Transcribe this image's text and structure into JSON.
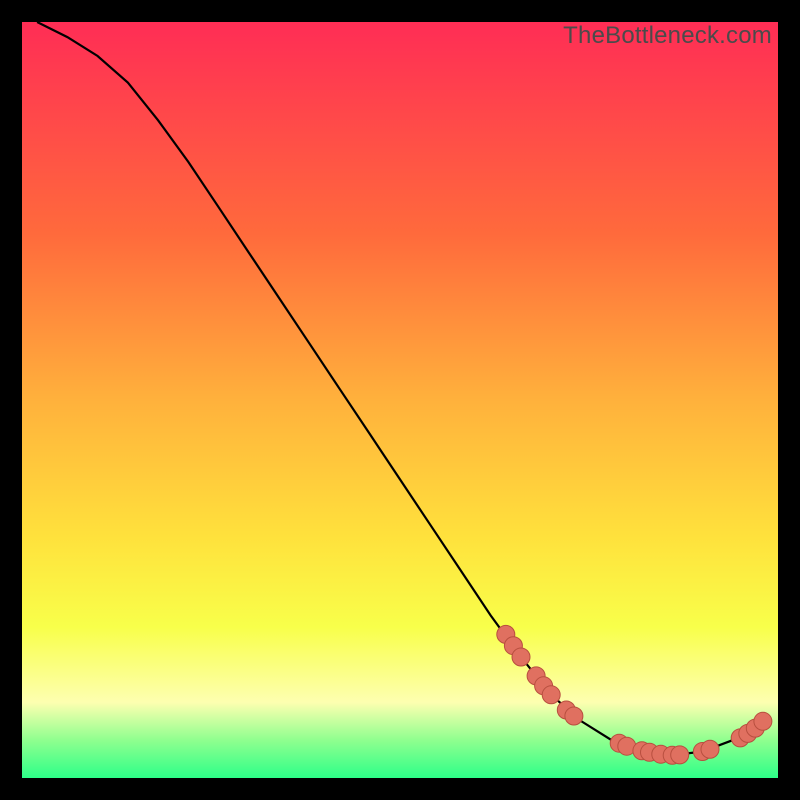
{
  "watermark": "TheBottleneck.com",
  "colors": {
    "background": "#000000",
    "gradient_top": "#ff2d55",
    "gradient_mid1": "#ff6a3c",
    "gradient_mid2": "#ffb13c",
    "gradient_mid3": "#ffe13c",
    "gradient_low": "#f8ff4a",
    "gradient_pale": "#fdffb0",
    "gradient_green1": "#8fff8f",
    "gradient_green2": "#2dff88",
    "curve": "#000000",
    "marker_fill": "#e07060",
    "marker_stroke": "#b84f3f"
  },
  "chart_data": {
    "type": "line",
    "title": "",
    "xlabel": "",
    "ylabel": "",
    "xlim": [
      0,
      100
    ],
    "ylim": [
      0,
      100
    ],
    "curve": [
      {
        "x": 2,
        "y": 100
      },
      {
        "x": 6,
        "y": 98
      },
      {
        "x": 10,
        "y": 95.5
      },
      {
        "x": 14,
        "y": 92
      },
      {
        "x": 18,
        "y": 87
      },
      {
        "x": 22,
        "y": 81.5
      },
      {
        "x": 26,
        "y": 75.5
      },
      {
        "x": 30,
        "y": 69.5
      },
      {
        "x": 34,
        "y": 63.5
      },
      {
        "x": 38,
        "y": 57.5
      },
      {
        "x": 42,
        "y": 51.5
      },
      {
        "x": 46,
        "y": 45.5
      },
      {
        "x": 50,
        "y": 39.5
      },
      {
        "x": 54,
        "y": 33.5
      },
      {
        "x": 58,
        "y": 27.5
      },
      {
        "x": 62,
        "y": 21.5
      },
      {
        "x": 66,
        "y": 16
      },
      {
        "x": 70,
        "y": 11
      },
      {
        "x": 74,
        "y": 7.5
      },
      {
        "x": 78,
        "y": 5
      },
      {
        "x": 82,
        "y": 3.5
      },
      {
        "x": 86,
        "y": 3
      },
      {
        "x": 90,
        "y": 3.5
      },
      {
        "x": 94,
        "y": 5
      },
      {
        "x": 98,
        "y": 7.5
      }
    ],
    "markers": [
      {
        "x": 64,
        "y": 19
      },
      {
        "x": 65,
        "y": 17.5
      },
      {
        "x": 66,
        "y": 16
      },
      {
        "x": 68,
        "y": 13.5
      },
      {
        "x": 69,
        "y": 12.2
      },
      {
        "x": 70,
        "y": 11
      },
      {
        "x": 72,
        "y": 9
      },
      {
        "x": 73,
        "y": 8.2
      },
      {
        "x": 79,
        "y": 4.6
      },
      {
        "x": 80,
        "y": 4.2
      },
      {
        "x": 82,
        "y": 3.6
      },
      {
        "x": 83,
        "y": 3.4
      },
      {
        "x": 84.5,
        "y": 3.15
      },
      {
        "x": 86,
        "y": 3
      },
      {
        "x": 87,
        "y": 3.05
      },
      {
        "x": 90,
        "y": 3.5
      },
      {
        "x": 91,
        "y": 3.8
      },
      {
        "x": 95,
        "y": 5.3
      },
      {
        "x": 96,
        "y": 5.9
      },
      {
        "x": 97,
        "y": 6.6
      },
      {
        "x": 98,
        "y": 7.5
      }
    ]
  }
}
